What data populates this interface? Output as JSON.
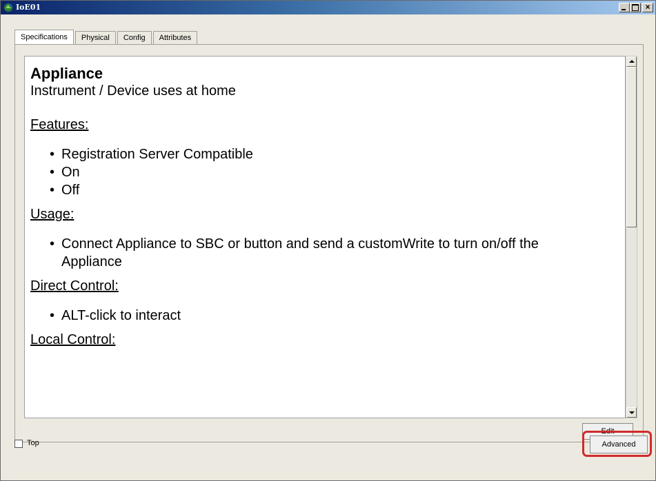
{
  "window": {
    "title": "IoE01",
    "icon": "packet-tracer-device-icon",
    "controls": [
      "minimize-icon",
      "maximize-icon",
      "close-icon"
    ],
    "close_glyph": "×"
  },
  "tabs": [
    {
      "label": "Specifications",
      "active": true
    },
    {
      "label": "Physical",
      "active": false
    },
    {
      "label": "Config",
      "active": false
    },
    {
      "label": "Attributes",
      "active": false
    }
  ],
  "spec": {
    "title": "Appliance",
    "subtitle": "Instrument / Device uses at home",
    "features_heading": "Features:",
    "features": [
      "Registration Server Compatible",
      "On",
      "Off"
    ],
    "usage_heading": "Usage:",
    "usage": [
      "Connect Appliance to SBC or button and send a customWrite to turn on/off the Appliance"
    ],
    "direct_heading": "Direct Control:",
    "direct": [
      "ALT-click to interact"
    ],
    "local_heading": "Local Control:"
  },
  "buttons": {
    "edit": "Edit",
    "advanced": "Advanced"
  },
  "top_checkbox": {
    "label": "Top",
    "checked": false
  },
  "colors": {
    "highlight": "#d12a2a",
    "titlebar_start": "#0a246a",
    "titlebar_end": "#a6caf0"
  }
}
